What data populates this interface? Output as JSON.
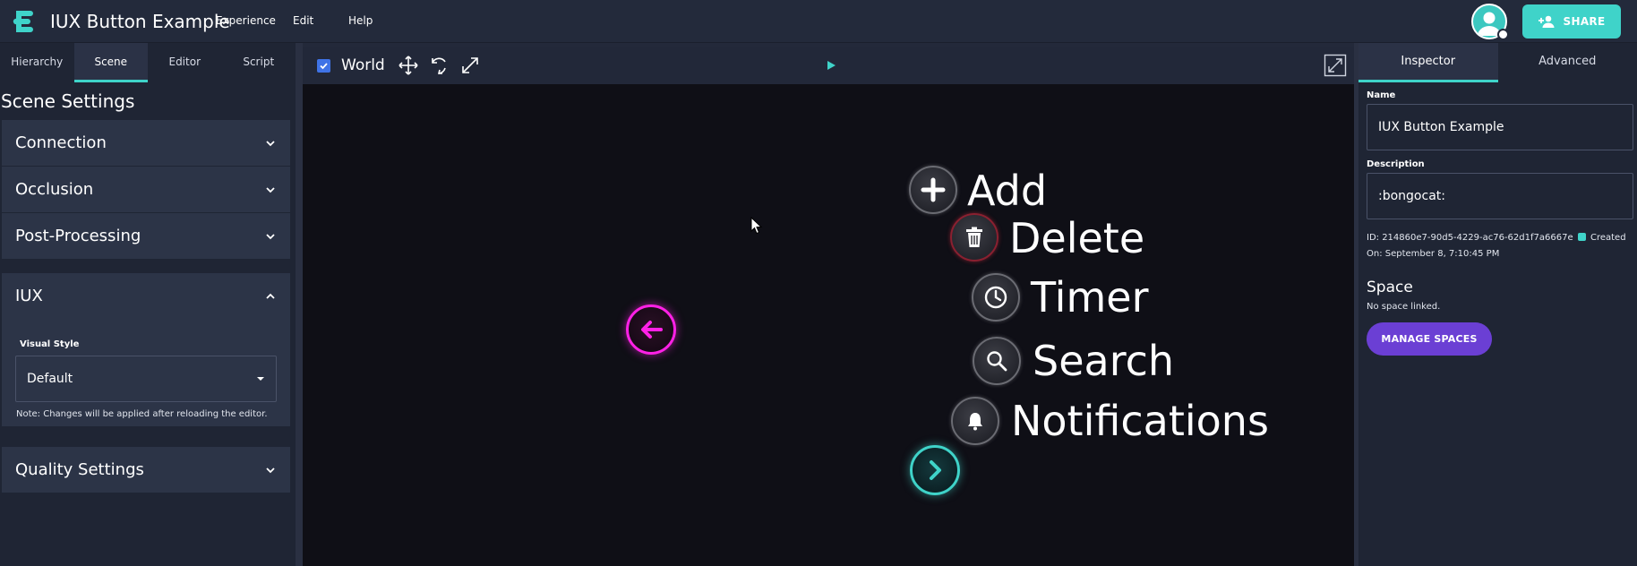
{
  "app": {
    "title": "IUX Button Example",
    "menu": [
      "Experience",
      "Edit",
      "Help"
    ],
    "share_label": "SHARE"
  },
  "colors": {
    "accent": "#3fd3c9",
    "purple": "#6b3fd4",
    "pink": "#ff21e6",
    "panel": "#1f2534",
    "viewport": "#0f0f16"
  },
  "left_panel": {
    "tabs": [
      "Hierarchy",
      "Scene",
      "Editor",
      "Script"
    ],
    "active_tab": "Scene",
    "title": "Scene Settings",
    "sections": {
      "connection": "Connection",
      "occlusion": "Occlusion",
      "post_processing": "Post-Processing",
      "iux": "IUX",
      "quality": "Quality Settings"
    },
    "iux": {
      "visual_style_label": "Visual Style",
      "visual_style_value": "Default",
      "note": "Note: Changes will be applied after reloading the editor."
    }
  },
  "toolbar": {
    "world_label": "World",
    "world_checked": true,
    "icons": [
      "move-icon",
      "rotate-icon",
      "scale-icon",
      "play-icon",
      "fullscreen-icon"
    ]
  },
  "viewport": {
    "buttons": {
      "add": "Add",
      "delete": "Delete",
      "timer": "Timer",
      "search": "Search",
      "notifications": "Notifications"
    }
  },
  "right_panel": {
    "tabs": [
      "Inspector",
      "Advanced"
    ],
    "active_tab": "Inspector",
    "name_label": "Name",
    "name_value": "IUX Button Example",
    "description_label": "Description",
    "description_value": ":bongocat:",
    "id_text": "ID: 214860e7-90d5-4229-ac76-62d1f7a6667e",
    "created_text": "Created On: September 8, 7:10:45 PM",
    "space_title": "Space",
    "space_note": "No space linked.",
    "manage_label": "MANAGE SPACES"
  }
}
